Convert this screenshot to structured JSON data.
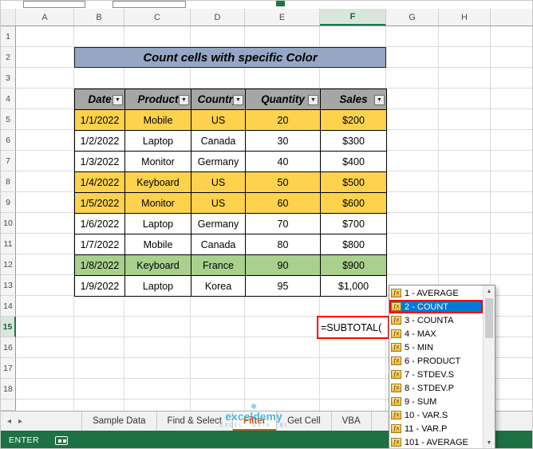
{
  "grid": {
    "columns": [
      "A",
      "B",
      "C",
      "D",
      "E",
      "F",
      "G",
      "H"
    ],
    "selected_column": "F",
    "rows": [
      "1",
      "2",
      "3",
      "4",
      "5",
      "6",
      "7",
      "8",
      "9",
      "10",
      "11",
      "12",
      "13",
      "14",
      "15",
      "16",
      "17",
      "18"
    ],
    "selected_row": "15"
  },
  "title_banner": "Count cells with specific Color",
  "table": {
    "headers": [
      "Date",
      "Product",
      "Country",
      "Quantity",
      "Sales"
    ],
    "rows": [
      {
        "cells": [
          "1/1/2022",
          "Mobile",
          "US",
          "20",
          "$200"
        ],
        "fill": "gold"
      },
      {
        "cells": [
          "1/2/2022",
          "Laptop",
          "Canada",
          "30",
          "$300"
        ],
        "fill": "white"
      },
      {
        "cells": [
          "1/3/2022",
          "Monitor",
          "Germany",
          "40",
          "$400"
        ],
        "fill": "white"
      },
      {
        "cells": [
          "1/4/2022",
          "Keyboard",
          "US",
          "50",
          "$500"
        ],
        "fill": "gold"
      },
      {
        "cells": [
          "1/5/2022",
          "Monitor",
          "US",
          "60",
          "$600"
        ],
        "fill": "gold"
      },
      {
        "cells": [
          "1/6/2022",
          "Laptop",
          "Germany",
          "70",
          "$700"
        ],
        "fill": "white"
      },
      {
        "cells": [
          "1/7/2022",
          "Mobile",
          "Canada",
          "80",
          "$800"
        ],
        "fill": "white"
      },
      {
        "cells": [
          "1/8/2022",
          "Keyboard",
          "France",
          "90",
          "$900"
        ],
        "fill": "green"
      },
      {
        "cells": [
          "1/9/2022",
          "Laptop",
          "Korea",
          "95",
          "$1,000"
        ],
        "fill": "white"
      }
    ]
  },
  "formula_cell": {
    "text": "=SUBTOTAL("
  },
  "function_dropdown": {
    "items": [
      "1 - AVERAGE",
      "2 - COUNT",
      "3 - COUNTA",
      "4 - MAX",
      "5 - MIN",
      "6 - PRODUCT",
      "7 - STDEV.S",
      "8 - STDEV.P",
      "9 - SUM",
      "10 - VAR.S",
      "11 - VAR.P",
      "101 - AVERAGE"
    ],
    "selected": "2 - COUNT"
  },
  "sheet_tabs": {
    "tabs": [
      "Sample Data",
      "Find & Select",
      "Filter",
      "Get Cell",
      "VBA"
    ],
    "active": "Filter"
  },
  "status_bar": {
    "mode": "ENTER"
  },
  "watermark": {
    "brand": "exceldemy",
    "sub": "EXCEL · DATA · BI"
  },
  "colors": {
    "excel_green": "#217346",
    "row_gold": "#FFD24D",
    "row_green": "#A9D08E",
    "row_white": "#FFFFFF",
    "table_header_gray": "#A6A6A6",
    "title_fill": "#95A7C4",
    "selection_blue": "#0078D7",
    "annotation_red": "#FF0000",
    "active_tab_orange": "#BF5712"
  }
}
